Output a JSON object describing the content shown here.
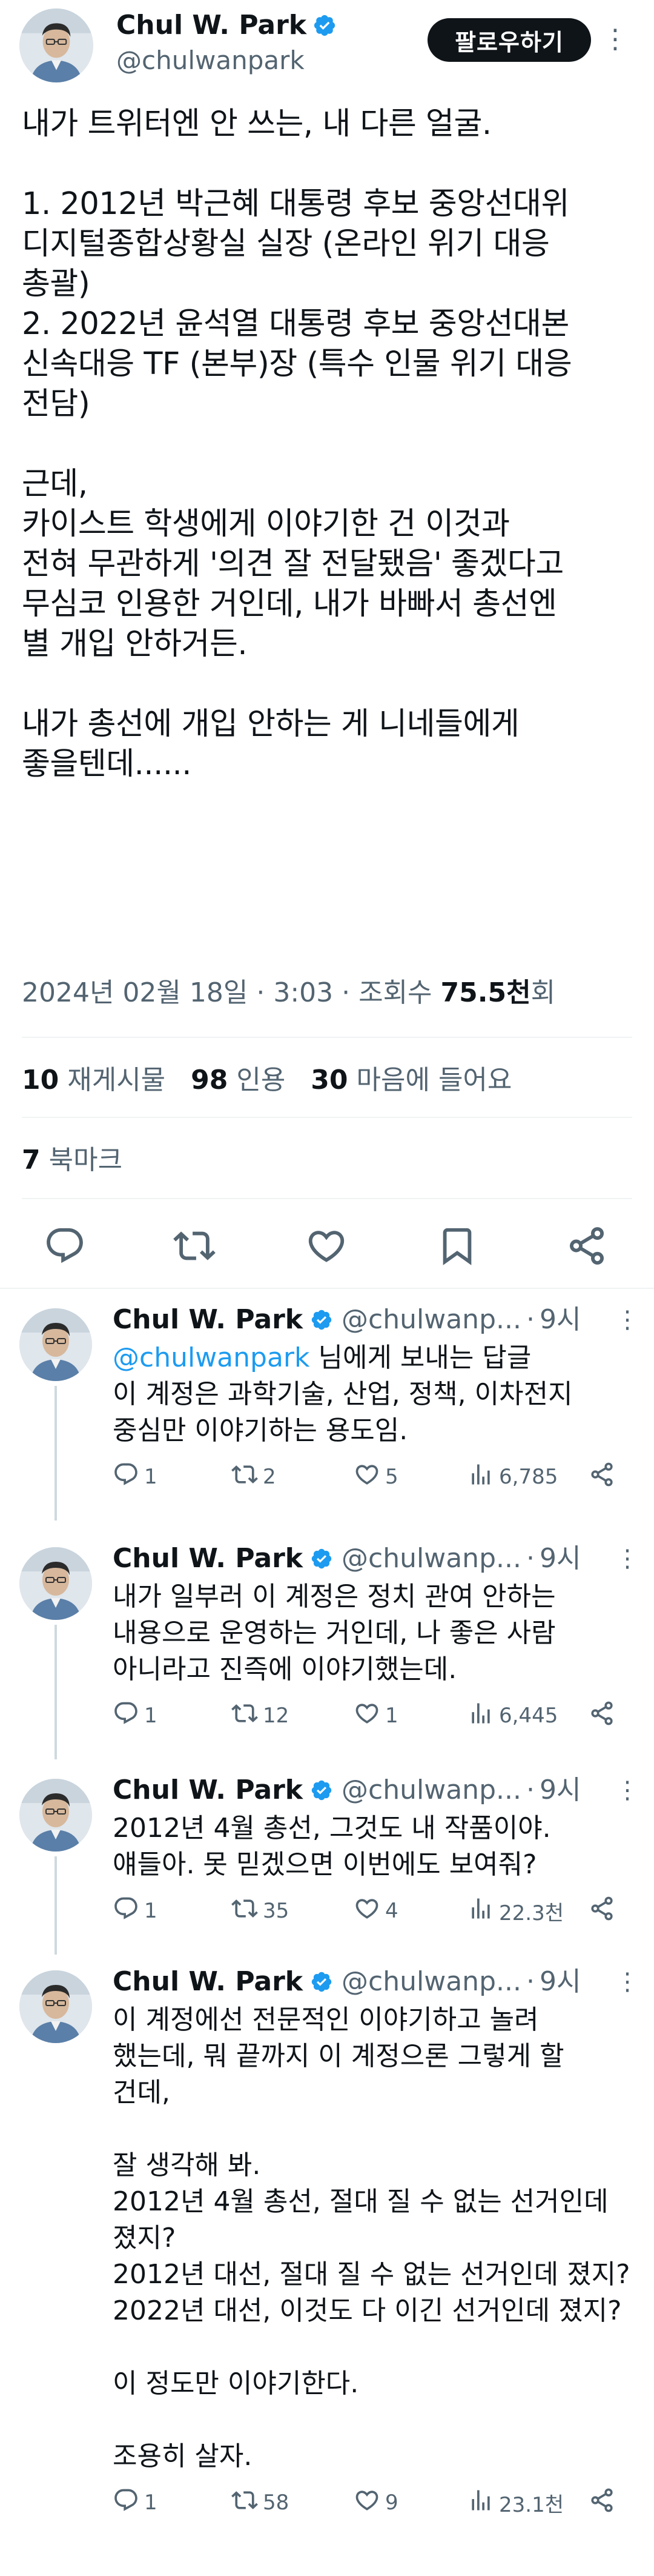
{
  "main": {
    "name": "Chul W. Park",
    "handle": "@chulwanpark",
    "follow_label": "팔로우하기",
    "more": "⋮",
    "text_lines": [
      "내가 트위터엔 안 쓰는, 내 다른 얼굴.",
      "",
      "1. 2012년 박근혜 대통령 후보 중앙선대위",
      "디지털종합상황실 실장 (온라인 위기 대응",
      "총괄)",
      "2. 2022년 윤석열 대통령 후보 중앙선대본",
      "신속대응 TF (본부)장 (특수 인물 위기 대응",
      "전담)",
      "",
      "근데,",
      "카이스트 학생에게 이야기한 건 이것과",
      "전혀 무관하게 '의견 잘 전달됐음' 좋겠다고",
      "무심코 인용한 거인데, 내가 바빠서 총선엔",
      "별 개입 안하거든.",
      "",
      "내가 총선에 개입 안하는 게 니네들에게",
      "좋을텐데......"
    ],
    "date": "2024년 02월 18일 · 3:03 · 조회수",
    "views": "75.5천",
    "views_suffix": "회",
    "retweets_count": "10",
    "retweets_label": "재게시물",
    "quotes_count": "98",
    "quotes_label": "인용",
    "likes_count": "30",
    "likes_label": "마음에 들어요",
    "bookmarks_count": "7",
    "bookmarks_label": "북마크"
  },
  "replies": [
    {
      "name": "Chul W. Park",
      "handle": "@chulwanp...",
      "time": "9시",
      "lines": [
        {
          "text": "@chulwanpark",
          "suffix": " 님에게 보내는 답글",
          "mention": true
        },
        {
          "text": "이 계정은 과학기술, 산업, 정책, 이차전지"
        },
        {
          "text": "중심만 이야기하는 용도임."
        }
      ],
      "reply_count": "1",
      "retweet_count": "2",
      "like_count": "5",
      "view_count": "6,785"
    },
    {
      "name": "Chul W. Park",
      "handle": "@chulwanp...",
      "time": "9시",
      "lines": [
        {
          "text": "내가 일부러 이 계정은 정치 관여 안하는"
        },
        {
          "text": "내용으로 운영하는 거인데, 나 좋은 사람"
        },
        {
          "text": "아니라고 진즉에 이야기했는데."
        }
      ],
      "reply_count": "1",
      "retweet_count": "12",
      "like_count": "1",
      "view_count": "6,445"
    },
    {
      "name": "Chul W. Park",
      "handle": "@chulwanp...",
      "time": "9시",
      "lines": [
        {
          "text": "2012년 4월 총선, 그것도 내 작품이야."
        },
        {
          "text": "얘들아. 못 믿겠으면 이번에도 보여줘?"
        }
      ],
      "reply_count": "1",
      "retweet_count": "35",
      "like_count": "4",
      "view_count": "22.3천"
    },
    {
      "name": "Chul W. Park",
      "handle": "@chulwanp...",
      "time": "9시",
      "lines": [
        {
          "text": "이 계정에선 전문적인 이야기하고 놀려"
        },
        {
          "text": "했는데, 뭐 끝까지 이 계정으론 그렇게 할"
        },
        {
          "text": "건데,"
        },
        {
          "text": ""
        },
        {
          "text": "잘 생각해 봐."
        },
        {
          "text": "2012년 4월 총선, 절대 질 수 없는 선거인데"
        },
        {
          "text": "졌지?"
        },
        {
          "text": "2012년 대선, 절대 질 수 없는 선거인데 졌지?"
        },
        {
          "text": "2022년 대선, 이것도 다 이긴 선거인데 졌지?"
        },
        {
          "text": ""
        },
        {
          "text": "이 정도만 이야기한다."
        },
        {
          "text": ""
        },
        {
          "text": "조용히 살자."
        }
      ],
      "reply_count": "1",
      "retweet_count": "58",
      "like_count": "9",
      "view_count": "23.1천"
    }
  ],
  "colors": {
    "text": "#0f1419",
    "muted": "#536471",
    "link": "#1d9bf0",
    "verified": "#1d9bf0",
    "divider": "#eff3f4"
  }
}
